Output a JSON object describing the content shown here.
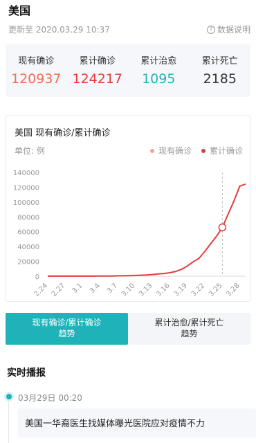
{
  "header": {
    "title": "美国",
    "updated": "更新至 2020.03.29 10:37",
    "help_label": "数据说明",
    "help_icon": "question-circle-icon"
  },
  "stats": [
    {
      "label": "现有确诊",
      "value": "120937",
      "color": "#f06e50"
    },
    {
      "label": "累计确诊",
      "value": "124217",
      "color": "#e23b3b"
    },
    {
      "label": "累计治愈",
      "value": "1095",
      "color": "#24b3b6"
    },
    {
      "label": "累计死亡",
      "value": "2185",
      "color": "#333333"
    }
  ],
  "chart": {
    "title": "美国 现有确诊/累计确诊",
    "unit": "单位: 例",
    "legend": [
      {
        "label": "现有确诊",
        "color": "#f7a58c"
      },
      {
        "label": "累计确诊",
        "color": "#e23b3b"
      }
    ]
  },
  "chart_data": {
    "type": "line",
    "title": "美国 现有确诊/累计确诊",
    "ylabel": "单位: 例",
    "ylim": [
      0,
      140000
    ],
    "yticks": [
      0,
      20000,
      40000,
      60000,
      80000,
      100000,
      120000,
      140000
    ],
    "xticks": [
      "2.24",
      "2.27",
      "3.1",
      "3.4",
      "3.7",
      "3.10",
      "3.13",
      "3.16",
      "3.19",
      "3.22",
      "3.25",
      "3.28"
    ],
    "x": [
      "2.24",
      "2.25",
      "2.26",
      "2.27",
      "2.28",
      "2.29",
      "3.1",
      "3.2",
      "3.3",
      "3.4",
      "3.5",
      "3.6",
      "3.7",
      "3.8",
      "3.9",
      "3.10",
      "3.11",
      "3.12",
      "3.13",
      "3.14",
      "3.15",
      "3.16",
      "3.17",
      "3.18",
      "3.19",
      "3.20",
      "3.21",
      "3.22",
      "3.23",
      "3.24",
      "3.25",
      "3.26",
      "3.27",
      "3.28",
      "3.29"
    ],
    "series": [
      {
        "name": "累计确诊",
        "color": "#e23b3b",
        "values": [
          53,
          53,
          59,
          60,
          62,
          68,
          75,
          100,
          124,
          158,
          221,
          319,
          435,
          541,
          704,
          994,
          1301,
          1697,
          2247,
          2943,
          3680,
          4663,
          6411,
          9259,
          13789,
          19383,
          24207,
          33546,
          43734,
          53740,
          65778,
          83836,
          101657,
          121478,
          124217
        ]
      }
    ],
    "highlight_index": 30,
    "grid": false,
    "legend_position": "top-right"
  },
  "tabs": [
    {
      "line1": "现有确诊/累计确诊",
      "line2": "趋势",
      "active": true
    },
    {
      "line1": "累计治愈/累计死亡",
      "line2": "趋势",
      "active": false
    }
  ],
  "live": {
    "title": "实时播报",
    "time": "03月29日  00:20",
    "headline": "美国一华裔医生找媒体曝光医院应对疫情不力"
  }
}
